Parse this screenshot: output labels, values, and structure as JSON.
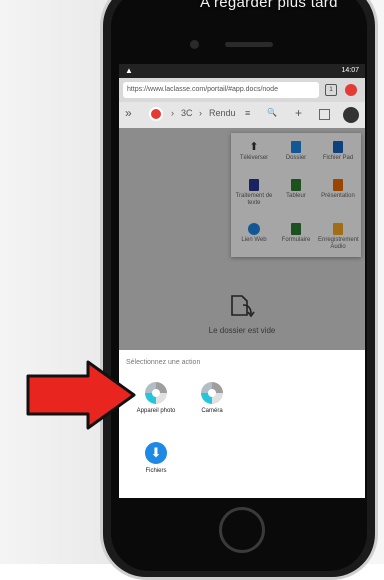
{
  "video_title": "A regarder plus tard",
  "status_bar": {
    "warning_glyph": "▲",
    "time": "14:07"
  },
  "browser": {
    "url": "https://www.laclasse.com/portail/#app.docs/node",
    "tabs_count": "1"
  },
  "app_toolbar": {
    "breadcrumb_sep1": "›",
    "breadcrumb_item1": "3C",
    "breadcrumb_sep2": "›",
    "breadcrumb_item2": "Rendu",
    "menu_glyph": "≡",
    "search_glyph": "🔍",
    "add_glyph": "+"
  },
  "create_menu": {
    "items": [
      {
        "label": "Téléverser",
        "icon": "upload-icon",
        "color": "#444444"
      },
      {
        "label": "Dossier",
        "icon": "folder-icon",
        "color": "#1e88e5"
      },
      {
        "label": "Fichier Pad",
        "icon": "pad-file-icon",
        "color": "#1565c0"
      },
      {
        "label": "Traitement de texte",
        "icon": "text-document-icon",
        "color": "#283593"
      },
      {
        "label": "Tableur",
        "icon": "spreadsheet-icon",
        "color": "#2e7d32"
      },
      {
        "label": "Présentation",
        "icon": "presentation-icon",
        "color": "#ef6c00"
      },
      {
        "label": "Lien Web",
        "icon": "web-link-icon",
        "color": "#1e88e5"
      },
      {
        "label": "Formulaire",
        "icon": "form-icon",
        "color": "#2e7d32"
      },
      {
        "label": "Enregistrement Audio",
        "icon": "audio-record-icon",
        "color": "#f9a825"
      }
    ]
  },
  "empty_state": {
    "text": "Le dossier est vide"
  },
  "action_sheet": {
    "title": "Sélectionnez une action",
    "options": [
      {
        "label": "Appareil photo",
        "icon": "camera-app-icon"
      },
      {
        "label": "Caméra",
        "icon": "video-camera-icon"
      },
      {
        "label": "Fichiers",
        "icon": "download-files-icon"
      }
    ]
  },
  "colors": {
    "accent": "#e53935",
    "arrow": "#e8261f",
    "files_blue": "#1e88e5"
  }
}
